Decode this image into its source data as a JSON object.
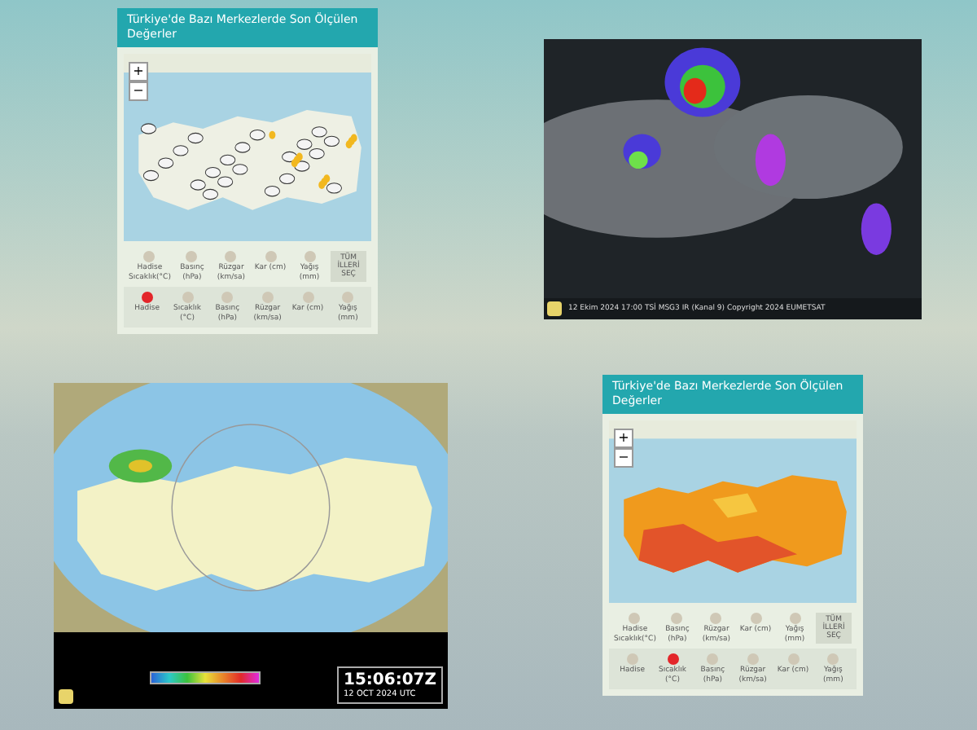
{
  "panels": [
    {
      "kind": "widget",
      "map": {
        "kind": "clouds"
      },
      "title": "Türkiye'de Bazı Merkezlerde Son Ölçülen Değerler",
      "zoom": [
        "+",
        "−"
      ],
      "select_all": "TÜM İLLERİ SEÇ",
      "rows": [
        [
          {
            "label": "Hadise",
            "unit": "Sıcaklık(°C)",
            "selected": false
          },
          {
            "label": "Basınç",
            "unit": "(hPa)",
            "selected": false
          },
          {
            "label": "Rüzgar",
            "unit": "(km/sa)",
            "selected": false
          },
          {
            "label": "Kar (cm)",
            "selected": false
          },
          {
            "label": "Yağış",
            "unit": "(mm)",
            "selected": false
          }
        ],
        [
          {
            "label": "Hadise",
            "selected": true
          },
          {
            "label": "Sıcaklık",
            "unit": "(°C)",
            "selected": false
          },
          {
            "label": "Basınç",
            "unit": "(hPa)",
            "selected": false
          },
          {
            "label": "Rüzgar",
            "unit": "(km/sa)",
            "selected": false
          },
          {
            "label": "Kar (cm)",
            "selected": false
          },
          {
            "label": "Yağış",
            "unit": "(mm)",
            "selected": false
          }
        ]
      ]
    },
    {
      "kind": "satellite",
      "caption": "12 Ekim 2024 17:00 TSİ    MSG3 IR (Kanal 9)    Copyright 2024 EUMETSAT"
    },
    {
      "kind": "radar",
      "time": "15:06:07Z",
      "date": "12 OCT 2024 UTC"
    },
    {
      "kind": "widget",
      "map": {
        "kind": "temperature"
      },
      "title": "Türkiye'de Bazı Merkezlerde Son Ölçülen Değerler",
      "zoom": [
        "+",
        "−"
      ],
      "select_all": "TÜM İLLERİ SEÇ",
      "rows": [
        [
          {
            "label": "Hadise",
            "unit": "Sıcaklık(°C)",
            "selected": false
          },
          {
            "label": "Basınç",
            "unit": "(hPa)",
            "selected": false
          },
          {
            "label": "Rüzgar",
            "unit": "(km/sa)",
            "selected": false
          },
          {
            "label": "Kar (cm)",
            "selected": false
          },
          {
            "label": "Yağış",
            "unit": "(mm)",
            "selected": false
          }
        ],
        [
          {
            "label": "Hadise",
            "selected": false
          },
          {
            "label": "Sıcaklık",
            "unit": "(°C)",
            "selected": true
          },
          {
            "label": "Basınç",
            "unit": "(hPa)",
            "selected": false
          },
          {
            "label": "Rüzgar",
            "unit": "(km/sa)",
            "selected": false
          },
          {
            "label": "Kar (cm)",
            "selected": false
          },
          {
            "label": "Yağış",
            "unit": "(mm)",
            "selected": false
          }
        ]
      ]
    }
  ]
}
